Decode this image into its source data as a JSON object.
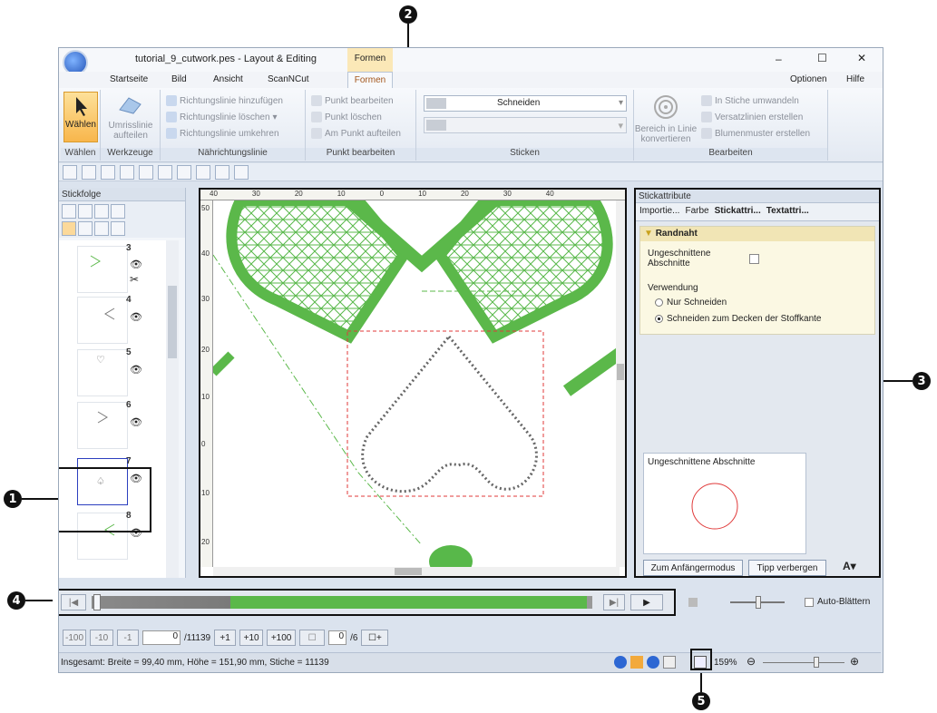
{
  "window": {
    "title": "tutorial_9_cutwork.pes - Layout & Editing",
    "context_tab": "Formen",
    "controls": [
      "–",
      "☐",
      "✕"
    ],
    "right_menus": [
      "Optionen",
      "Hilfe"
    ]
  },
  "ribbon_tabs": [
    "Startseite",
    "Bild",
    "Ansicht",
    "ScanNCut",
    "Formen"
  ],
  "ribbon": {
    "select_label": "Wählen",
    "outline_label": "Umrisslinie aufteilen",
    "group_select": "Wählen",
    "group_tools": "Werkzeuge",
    "dir_add": "Richtungslinie hinzufügen",
    "dir_delete": "Richtungslinie löschen",
    "dir_reverse": "Richtungslinie umkehren",
    "group_sewing_line": "Nährichtungslinie",
    "pt_edit": "Punkt bearbeiten",
    "pt_delete": "Punkt löschen",
    "pt_split": "Am Punkt aufteilen",
    "group_point": "Punkt bearbeiten",
    "sew_type": "Schneiden",
    "group_sticken": "Sticken",
    "convert_area": "Bereich in Linie konvertieren",
    "to_stitches": "In Stiche umwandeln",
    "offset_lines": "Versatzlinien erstellen",
    "flower": "Blumenmuster erstellen",
    "group_edit": "Bearbeiten"
  },
  "left_panel": {
    "title": "Stickfolge",
    "items": [
      {
        "num": "3"
      },
      {
        "num": "4"
      },
      {
        "num": "5"
      },
      {
        "num": "6"
      },
      {
        "num": "7"
      },
      {
        "num": "8"
      }
    ]
  },
  "ruler_labels_h": [
    "40",
    "30",
    "20",
    "10",
    "0",
    "10",
    "20",
    "30",
    "40"
  ],
  "ruler_labels_v": [
    "50",
    "40",
    "30",
    "20",
    "10",
    "0",
    "10",
    "20"
  ],
  "right_panel": {
    "title": "Stickattribute",
    "tabs": [
      "Importie...",
      "Farbe",
      "Stickattri...",
      "Textattri..."
    ],
    "section": "Randnaht",
    "uncut_label": "Ungeschnittene Abschnitte",
    "usage_label": "Verwendung",
    "opt1": "Nur Schneiden",
    "opt2": "Schneiden zum Decken der Stoffkante",
    "preview_label": "Ungeschnittene Abschnitte",
    "btn_beginner": "Zum Anfängermodus",
    "btn_hide_tip": "Tipp verbergen"
  },
  "simulator": {
    "auto_label": "Auto-Blättern",
    "progress": 0.99
  },
  "stitchbar": {
    "b_m100": "-100",
    "b_m10": "-10",
    "b_m1": "-1",
    "current": "0",
    "total": "/11139",
    "b_p1": "+1",
    "b_p10": "+10",
    "b_p100": "+100",
    "color_current": "0",
    "color_total": "/6"
  },
  "status": {
    "text": "Insgesamt: Breite = 99,40 mm, Höhe = 151,90 mm, Stiche = 11139",
    "zoom": "159%"
  },
  "callouts": [
    "1",
    "2",
    "3",
    "4",
    "5"
  ]
}
